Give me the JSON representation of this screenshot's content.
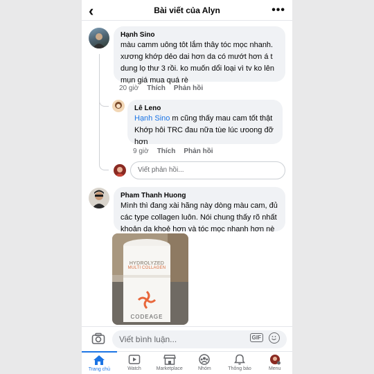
{
  "header": {
    "title": "Bài viết của Alyn",
    "back_icon": "chevron-left-icon",
    "more_icon": "more-dots-icon"
  },
  "comments": [
    {
      "author": "Hạnh Sino",
      "text": "màu camm uông tôt lắm thây tóc mọc nhanh. xương khớp dẻo dai hơn da có mướt hơn á t dung lọ thư 3 rồi. ko muốn dổi loại vì tv ko lên mụn giá mua quá rè",
      "time": "20 giờ",
      "like": "Thích",
      "reply": "Phản hồi"
    },
    {
      "author": "Lê Leno",
      "mention": "Hạnh Sino",
      "text": " m cũng thấy mau cam tốt thật Khớp hôi TRC đau nữa tùe lúc ưoong đỡ hơn",
      "time": "9 giờ",
      "like": "Thích",
      "reply": "Phản hồi"
    },
    {
      "author": "Pham Thanh Huong",
      "text": "Mình thì đang xài hãng này dòng màu cam, đủ các type collagen luôn. Nói chung thấy rõ nhất khoản da khoẻ hơn và tóc mọc nhanh hơn nè"
    }
  ],
  "reply_input": {
    "placeholder": "Viết phản hồi..."
  },
  "photo": {
    "label_line1": "HYDROLYZED",
    "label_line2": "MULTI COLLAGEN",
    "brand": "CODEAGE"
  },
  "composer": {
    "placeholder": "Viết bình luận...",
    "camera_icon": "camera-icon",
    "gif_label": "GIF",
    "emoji_icon": "emoji-icon"
  },
  "tabs": [
    {
      "label": "Trang chủ",
      "icon": "home-icon",
      "active": true
    },
    {
      "label": "Watch",
      "icon": "watch-icon"
    },
    {
      "label": "Marketplace",
      "icon": "marketplace-icon"
    },
    {
      "label": "Nhóm",
      "icon": "groups-icon"
    },
    {
      "label": "Thông báo",
      "icon": "bell-icon"
    },
    {
      "label": "Menu",
      "icon": "menu-avatar-icon"
    }
  ],
  "colors": {
    "accent": "#1b74e4",
    "bubble": "#f0f2f5",
    "secondary_text": "#65676b"
  }
}
